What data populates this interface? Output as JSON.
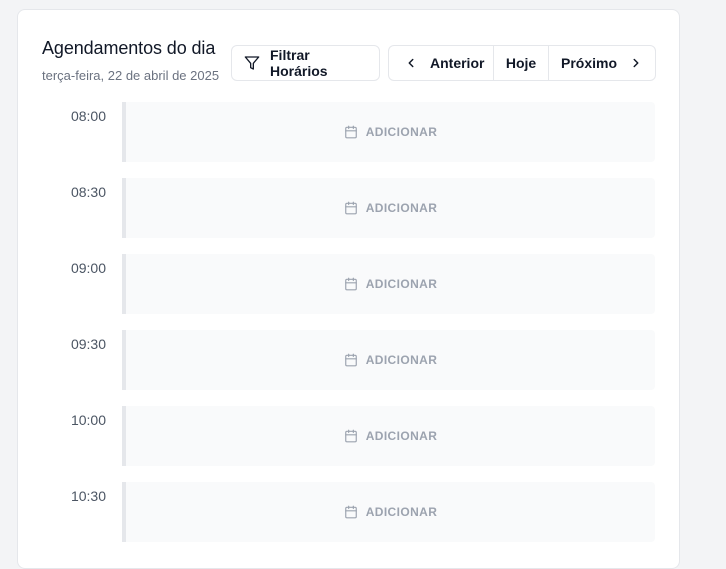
{
  "header": {
    "title": "Agendamentos do dia",
    "subtitle": "terça-feira, 22 de abril de 2025"
  },
  "toolbar": {
    "filter_label": "Filtrar Horários",
    "filter_icon": "filter-icon",
    "prev_label": "Anterior",
    "today_label": "Hoje",
    "next_label": "Próximo"
  },
  "slots": [
    {
      "time": "08:00",
      "action": "ADICIONAR"
    },
    {
      "time": "08:30",
      "action": "ADICIONAR"
    },
    {
      "time": "09:00",
      "action": "ADICIONAR"
    },
    {
      "time": "09:30",
      "action": "ADICIONAR"
    },
    {
      "time": "10:00",
      "action": "ADICIONAR"
    },
    {
      "time": "10:30",
      "action": "ADICIONAR"
    }
  ],
  "colors": {
    "slot_bg": "#f9fafb",
    "slot_border": "#e5e7eb",
    "muted_text": "#9ca3af"
  }
}
